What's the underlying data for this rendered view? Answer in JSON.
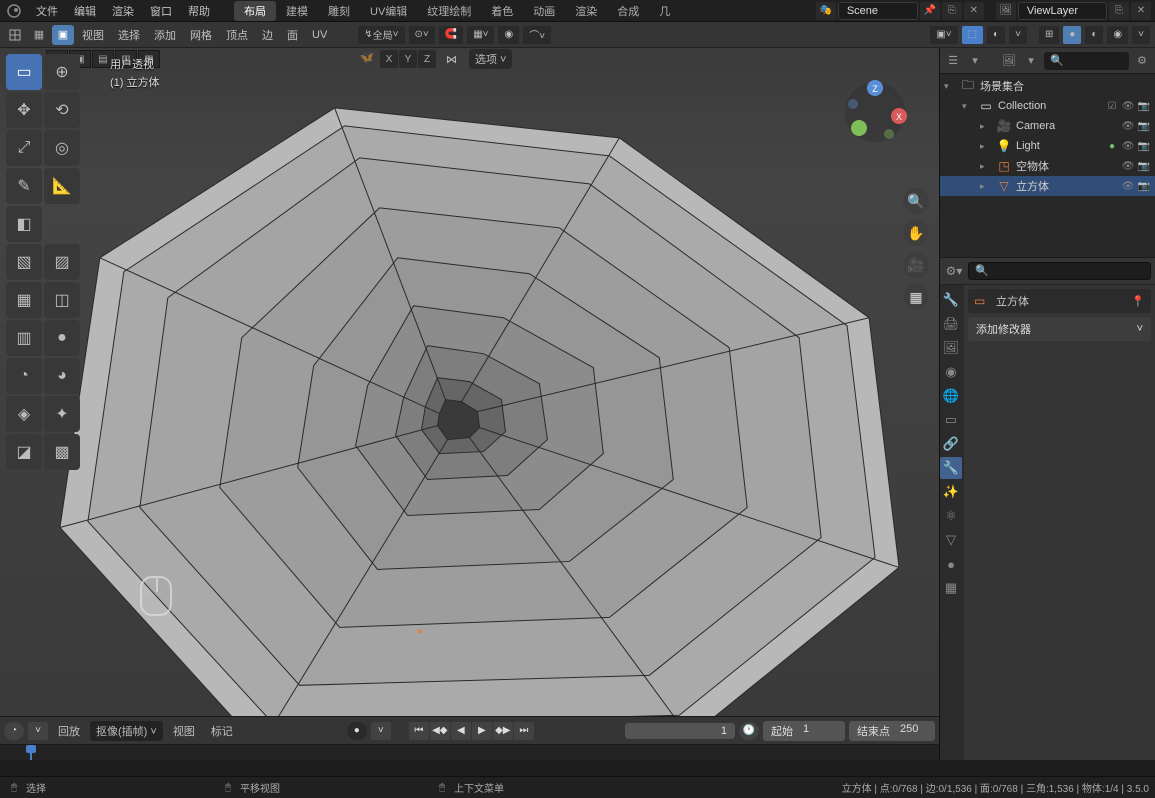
{
  "menubar": {
    "items": [
      "文件",
      "编辑",
      "渲染",
      "窗口",
      "帮助"
    ],
    "workspaces": [
      "布局",
      "建模",
      "雕刻",
      "UV编辑",
      "纹理绘制",
      "着色",
      "动画",
      "渲染",
      "合成",
      "几"
    ],
    "active_workspace": 0,
    "scene_label": "Scene",
    "viewlayer_label": "ViewLayer"
  },
  "header": {
    "items_left": [
      "视图",
      "选择",
      "添加",
      "网格",
      "顶点",
      "边",
      "面",
      "UV"
    ],
    "global_label": "全局",
    "options_label": "选项"
  },
  "viewport": {
    "info_line1": "用户透视",
    "info_line2": "(1) 立方体",
    "axes": [
      "X",
      "Y",
      "Z"
    ],
    "mirror_label": ""
  },
  "timeline": {
    "playback_label": "回放",
    "keying_label": "抠像(插帧)",
    "view_label": "视图",
    "marker_label": "标记",
    "current_frame": "1",
    "start_label": "起始",
    "start_val": "1",
    "end_label": "结束点",
    "end_val": "250"
  },
  "outliner": {
    "root": "场景集合",
    "collection": "Collection",
    "items": [
      {
        "icon": "camera",
        "label": "Camera",
        "color": "#7fbf7f"
      },
      {
        "icon": "light",
        "label": "Light",
        "color": "#e0c068"
      },
      {
        "icon": "empty",
        "label": "空物体",
        "color": "#e87d3e"
      },
      {
        "icon": "mesh",
        "label": "立方体",
        "color": "#e87d3e",
        "selected": true
      }
    ]
  },
  "properties": {
    "object_label": "立方体",
    "add_modifier_label": "添加修改器"
  },
  "statusbar": {
    "select_label": "选择",
    "pan_label": "平移视图",
    "context_label": "上下文菜单",
    "stats": "立方体 | 点:0/768 | 边:0/1,536 | 面:0/768 | 三角:1,536 | 物体:1/4 | 3.5.0"
  }
}
